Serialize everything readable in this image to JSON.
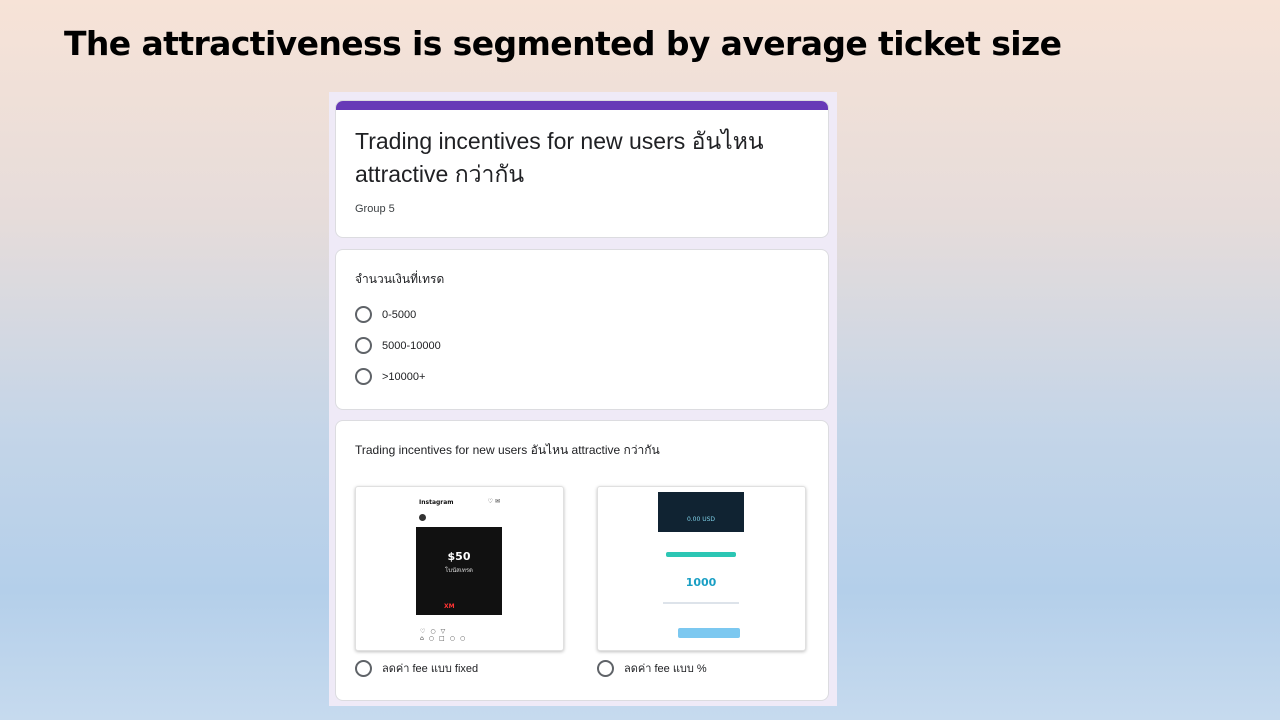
{
  "slide": {
    "title": "The attractiveness is segmented by average ticket size"
  },
  "form": {
    "accent_color": "#673ab7",
    "title": "Trading incentives for new users อันไหน attractive กว่ากัน",
    "description": "Group 5"
  },
  "question1": {
    "title": "จำนวนเงินที่เทรด",
    "options": [
      "0-5000",
      "5000-10000",
      ">10000+"
    ]
  },
  "question2": {
    "title": "Trading incentives for new users อันไหน attractive กว่ากัน",
    "option_a": {
      "label": "ลดค่า fee แบบ fixed",
      "image": {
        "app_name": "Instagram",
        "ad_amount": "$50",
        "ad_subtitle": "โบนัสเทรด",
        "ad_brand": "XM"
      }
    },
    "option_b": {
      "label": "ลดค่า fee แบบ %",
      "image": {
        "balance": "0.00 USD",
        "amount": "1000"
      }
    }
  }
}
